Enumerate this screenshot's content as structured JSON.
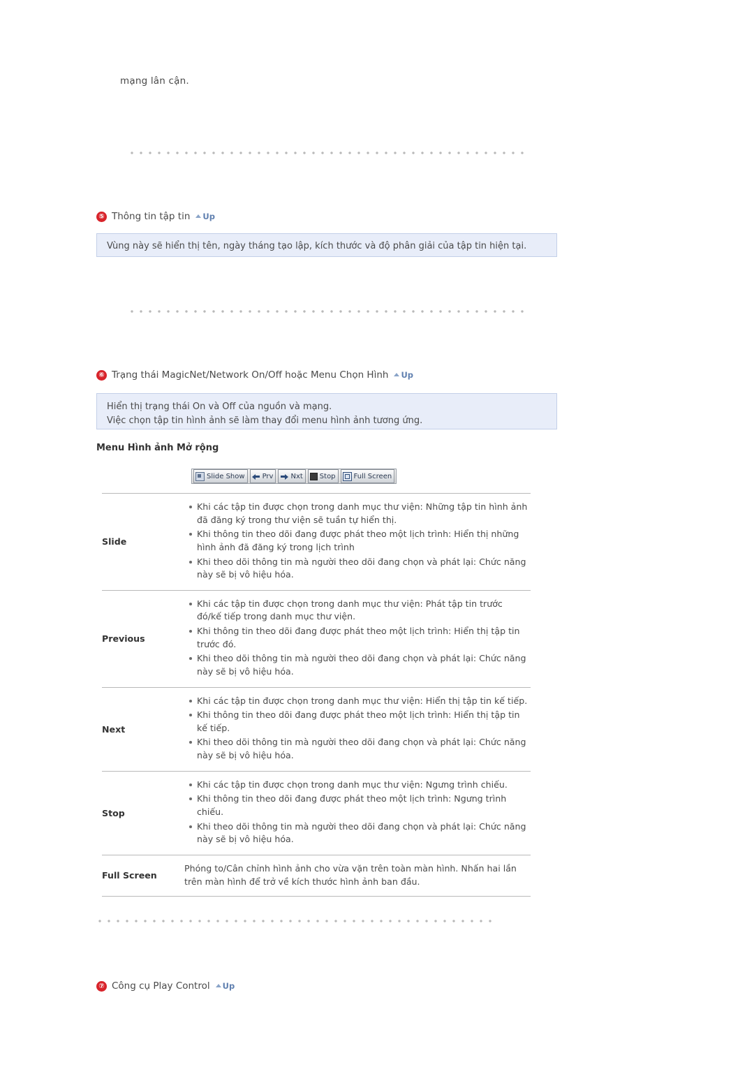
{
  "top_fragment": "mạng lân cận.",
  "sections": [
    {
      "number": "⑤",
      "title": "Thông tin tập tin",
      "up_label": "Up",
      "note": "Vùng này sẽ hiển thị tên, ngày tháng tạo lập, kích thước và độ phân giải của tập tin hiện tại."
    },
    {
      "number": "⑥",
      "title": "Trạng thái MagicNet/Network On/Off hoặc Menu Chọn Hình",
      "up_label": "Up",
      "note_lines": [
        "Hiển thị trạng thái On và Off của nguồn và mạng.",
        "Việc chọn tập tin hình ảnh sẽ làm thay đổi menu hình ảnh tương ứng."
      ]
    },
    {
      "number": "⑦",
      "title": "Công cụ Play Control",
      "up_label": "Up"
    }
  ],
  "subsection_title": "Menu Hình ảnh Mở rộng",
  "toolbar": {
    "buttons": [
      {
        "icon": "slide-show-icon",
        "label": "Slide Show"
      },
      {
        "icon": "arrow-left-icon",
        "label": "Prv"
      },
      {
        "icon": "arrow-right-icon",
        "label": "Nxt"
      },
      {
        "icon": "stop-square-icon",
        "label": "Stop"
      },
      {
        "icon": "full-screen-icon",
        "label": "Full Screen"
      }
    ]
  },
  "table": {
    "rows": [
      {
        "label": "Slide",
        "items": [
          "Khi các tập tin được chọn trong danh mục thư viện: Những tập tin hình ảnh đã đăng ký trong thư viện sẽ tuần tự hiển thị.",
          "Khi thông tin theo dõi đang được phát theo một lịch trình: Hiển thị những hình ảnh đã đăng ký trong lịch trình",
          "Khi theo dõi thông tin mà người theo dõi đang chọn và phát lại: Chức năng này sẽ bị vô hiệu hóa."
        ]
      },
      {
        "label": "Previous",
        "items": [
          "Khi các tập tin được chọn trong danh mục thư viện: Phát tập tin trước đó/kế tiếp trong danh mục thư viện.",
          "Khi thông tin theo dõi đang được phát theo một lịch trình: Hiển thị tập tin trước đó.",
          "Khi theo dõi thông tin mà người theo dõi đang chọn và phát lại: Chức năng này sẽ bị vô hiệu hóa."
        ]
      },
      {
        "label": "Next",
        "items": [
          "Khi các tập tin được chọn trong danh mục thư viện: Hiển thị tập tin kế tiếp.",
          "Khi thông tin theo dõi đang được phát theo một lịch trình: Hiển thị tập tin kế tiếp.",
          "Khi theo dõi thông tin mà người theo dõi đang chọn và phát lại: Chức năng này sẽ bị vô hiệu hóa."
        ]
      },
      {
        "label": "Stop",
        "items": [
          "Khi các tập tin được chọn trong danh mục thư viện: Ngưng trình chiếu.",
          "Khi thông tin theo dõi đang được phát theo một lịch trình: Ngưng trình chiếu.",
          "Khi theo dõi thông tin mà người theo dõi đang chọn và phát lại: Chức năng này sẽ bị vô hiệu hóa."
        ]
      },
      {
        "label": "Full Screen",
        "plain": "Phóng to/Cân chỉnh hình ảnh cho vừa vặn trên toàn màn hình. Nhấn hai lần trên màn hình để trở về kích thước hình ảnh ban đầu."
      }
    ]
  }
}
